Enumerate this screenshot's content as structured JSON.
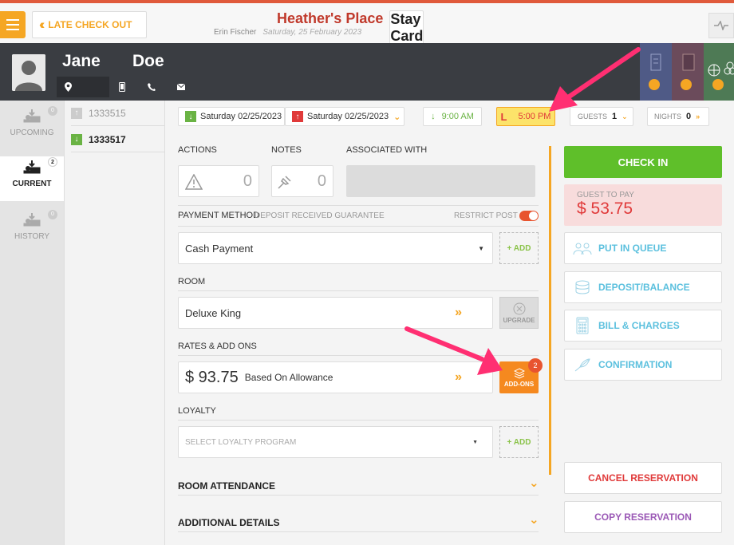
{
  "header": {
    "late_checkout": "LATE CHECK OUT",
    "hotel": "Heather's Place",
    "card_title": "Stay Card",
    "user": "Erin Fischer",
    "date": "Saturday, 25 February 2023"
  },
  "guest": {
    "first_name": "Jane",
    "last_name": "Doe"
  },
  "left_tabs": [
    {
      "label": "UPCOMING",
      "count": "0"
    },
    {
      "label": "CURRENT",
      "count": "2"
    },
    {
      "label": "HISTORY",
      "count": "0"
    }
  ],
  "confirmations": [
    "1333515",
    "1333517"
  ],
  "stay": {
    "arrival": "Saturday 02/25/2023",
    "departure": "Saturday 02/25/2023",
    "checkin_time": "9:00 AM",
    "checkout_time": "5:00 PM",
    "guests_label": "GUESTS",
    "guests": "1",
    "nights_label": "NIGHTS",
    "nights": "0"
  },
  "sections": {
    "actions": "ACTIONS",
    "actions_count": "0",
    "notes": "NOTES",
    "notes_count": "0",
    "associated": "ASSOCIATED WITH",
    "payment_method": "PAYMENT METHOD",
    "payment_sub": "DEPOSIT RECEIVED GUARANTEE",
    "restrict_post": "RESTRICT POST",
    "payment_value": "Cash Payment",
    "add": "+ ADD",
    "room": "ROOM",
    "room_value": "Deluxe King",
    "upgrade": "UPGRADE",
    "rates": "RATES & ADD ONS",
    "rate_amount": "$ 93.75",
    "rate_basis": "Based On Allowance",
    "addons": "ADD-ONS",
    "addons_count": "2",
    "loyalty": "LOYALTY",
    "loyalty_placeholder": "SELECT LOYALTY PROGRAM",
    "room_attendance": "ROOM ATTENDANCE",
    "additional": "ADDITIONAL DETAILS"
  },
  "right_panel": {
    "check_in": "CHECK IN",
    "guest_to_pay_label": "GUEST TO PAY",
    "guest_to_pay": "$ 53.75",
    "put_in_queue": "PUT IN QUEUE",
    "deposit_balance": "DEPOSIT/BALANCE",
    "bill_charges": "BILL & CHARGES",
    "confirmation": "CONFIRMATION",
    "cancel": "CANCEL RESERVATION",
    "copy": "COPY RESERVATION"
  },
  "colors": {
    "accent": "#f5a623",
    "brand_red": "#c0392b",
    "green": "#5fbf2a",
    "highlight": "#ff2f72"
  }
}
